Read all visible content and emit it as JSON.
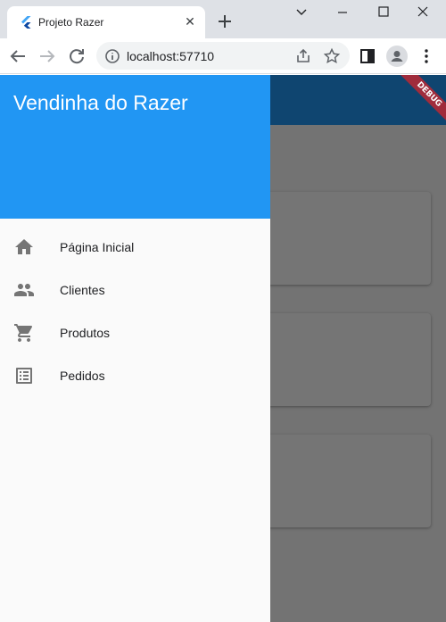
{
  "browser": {
    "tab_title": "Projeto Razer",
    "url": "localhost:57710"
  },
  "app": {
    "drawer_title": "Vendinha do Razer",
    "debug_banner": "DEBUG",
    "menu": [
      {
        "label": "Página Inicial",
        "icon": "home-icon"
      },
      {
        "label": "Clientes",
        "icon": "people-icon"
      },
      {
        "label": "Produtos",
        "icon": "cart-icon"
      },
      {
        "label": "Pedidos",
        "icon": "list-icon"
      }
    ]
  },
  "colors": {
    "primary": "#2196f3",
    "debug_ribbon": "#a02c3c",
    "menu_icon": "#757575"
  }
}
